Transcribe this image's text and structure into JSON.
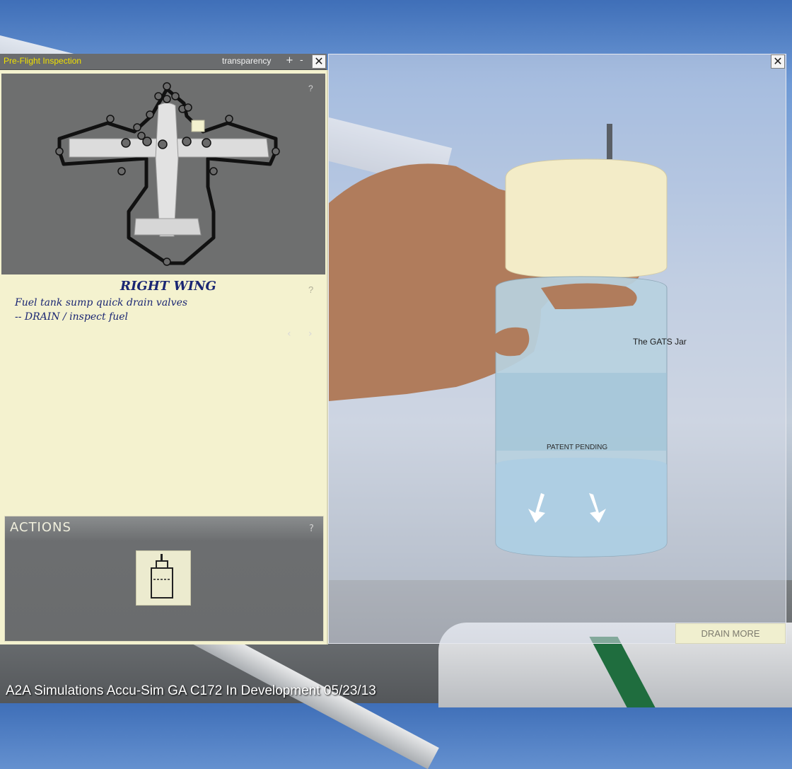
{
  "window": {
    "title": "Pre-Flight Inspection",
    "transparency_label": "transparency",
    "plus_label": "+",
    "minus_label": "-",
    "close_label": "✕"
  },
  "map": {
    "help_label": "?",
    "prev_label": "‹",
    "next_label": "›"
  },
  "inspection": {
    "heading": "RIGHT WING",
    "help_label": "?",
    "lines": [
      "Fuel tank sump quick drain valves",
      "-- DRAIN / inspect fuel"
    ]
  },
  "actions": {
    "title": "ACTIONS",
    "help_label": "?"
  },
  "photo": {
    "close_label": "✕",
    "jar_brand": "The GATS Jar",
    "jar_note": "PATENT PENDING",
    "drain_button": "DRAIN MORE"
  },
  "footer": {
    "text": "A2A Simulations Accu-Sim GA C172 In Development 05/23/13"
  },
  "colors": {
    "title_yellow": "#f0e000",
    "note_paper": "#f4f2cf",
    "ink_blue": "#1a2673"
  }
}
